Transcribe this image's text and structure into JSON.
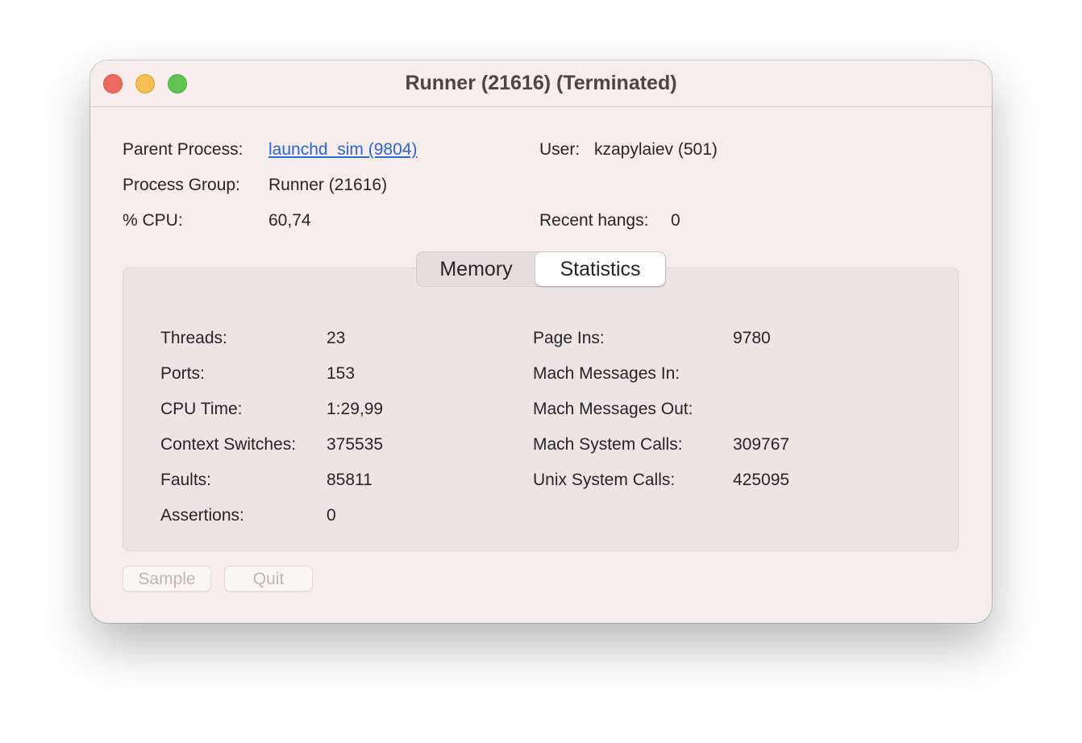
{
  "window": {
    "title": "Runner (21616) (Terminated)"
  },
  "info": {
    "parent_process_label": "Parent Process:",
    "parent_process_value": "launchd_sim (9804)",
    "user_label": "User:",
    "user_value": "kzapylaiev (501)",
    "process_group_label": "Process Group:",
    "process_group_value": "Runner (21616)",
    "cpu_label": "% CPU:",
    "cpu_value": "60,74",
    "recent_hangs_label": "Recent hangs:",
    "recent_hangs_value": "0"
  },
  "tabs": {
    "memory": "Memory",
    "statistics": "Statistics",
    "selected": "Statistics"
  },
  "stats_left": [
    {
      "label": "Threads:",
      "value": "23"
    },
    {
      "label": "Ports:",
      "value": "153"
    },
    {
      "label": "CPU Time:",
      "value": "1:29,99"
    },
    {
      "label": "Context Switches:",
      "value": "375535"
    },
    {
      "label": "Faults:",
      "value": "85811"
    },
    {
      "label": "Assertions:",
      "value": "0"
    }
  ],
  "stats_right": [
    {
      "label": "Page Ins:",
      "value": "9780"
    },
    {
      "label": "Mach Messages In:",
      "value": ""
    },
    {
      "label": "Mach Messages Out:",
      "value": ""
    },
    {
      "label": "Mach System Calls:",
      "value": "309767"
    },
    {
      "label": "Unix System Calls:",
      "value": "425095"
    }
  ],
  "buttons": {
    "sample": "Sample",
    "quit": "Quit"
  }
}
